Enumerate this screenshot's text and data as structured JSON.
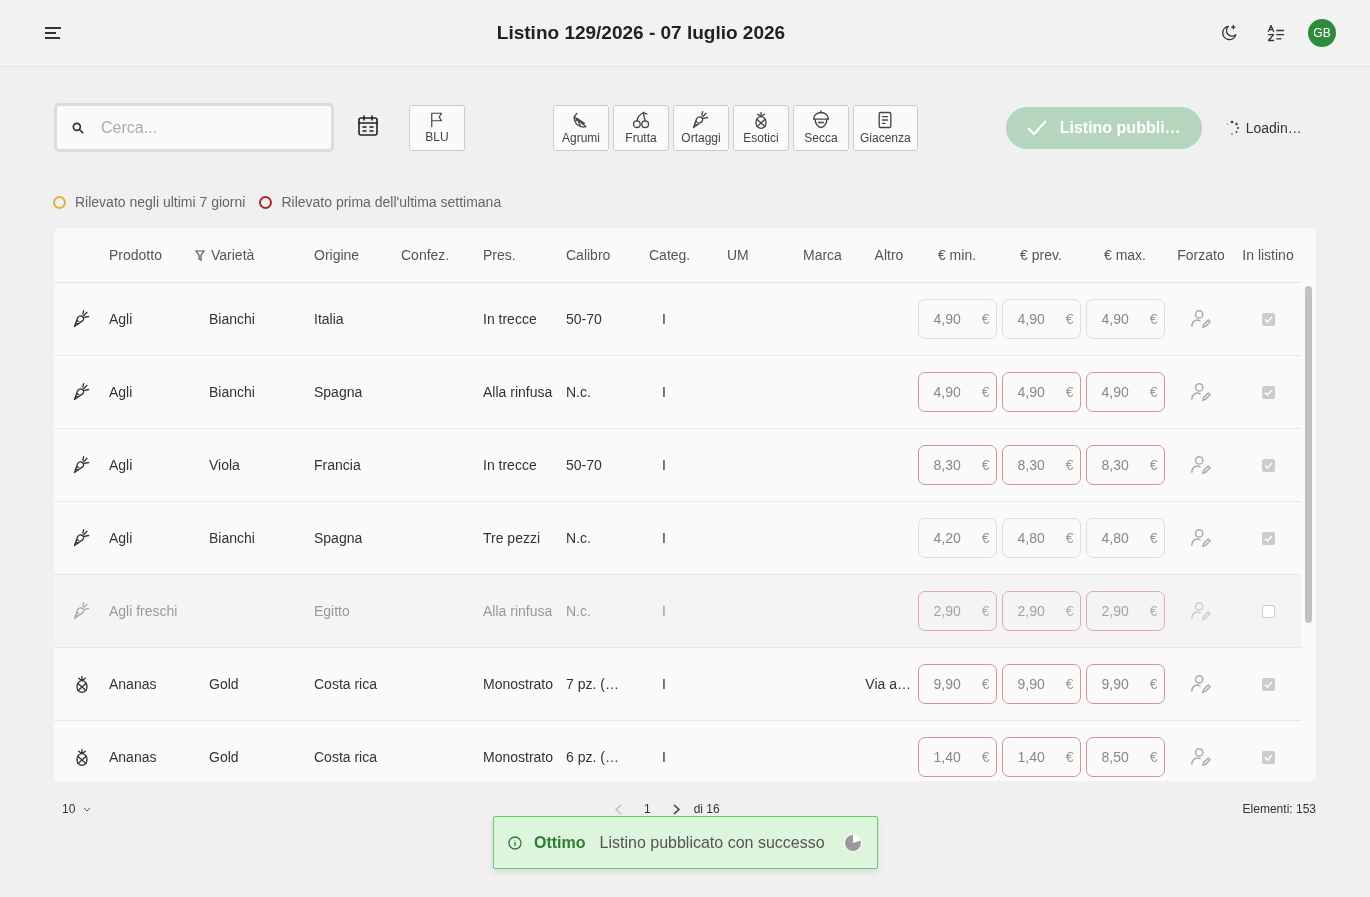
{
  "header": {
    "title": "Listino 129/2026 - 07 luglio 2026",
    "avatar": "GB"
  },
  "toolbar": {
    "search": {
      "placeholder": "Cerca..."
    },
    "flag_button": "BLU",
    "categories": [
      {
        "label": "Agrumi",
        "kind": "citrus"
      },
      {
        "label": "Frutta",
        "kind": "cherry"
      },
      {
        "label": "Ortaggi",
        "kind": "carrot"
      },
      {
        "label": "Esotici",
        "kind": "pineapple"
      },
      {
        "label": "Secca",
        "kind": "acorn"
      },
      {
        "label": "Giacenza",
        "kind": "document"
      }
    ],
    "publish_button": "Listino pubbli…",
    "loading": "Loadin…"
  },
  "legend": [
    {
      "label": "Rilevato negli ultimi 7 giorni",
      "color": "#e0b040"
    },
    {
      "label": "Rilevato prima dell'ultima settimana",
      "color": "#a52a2a"
    }
  ],
  "table": {
    "columns": [
      {
        "label": "Prodotto",
        "filter": false
      },
      {
        "label": "Varietà",
        "filter": true
      },
      {
        "label": "Origine",
        "filter": false
      },
      {
        "label": "Confez.",
        "filter": false
      },
      {
        "label": "Pres.",
        "filter": false
      },
      {
        "label": "Calibro",
        "filter": false
      },
      {
        "label": "Categ.",
        "filter": false
      },
      {
        "label": "UM",
        "filter": false
      },
      {
        "label": "Marca",
        "filter": false
      },
      {
        "label": "Altro",
        "filter": false
      },
      {
        "label": "€ min.",
        "filter": false
      },
      {
        "label": "€ prev.",
        "filter": false
      },
      {
        "label": "€ max.",
        "filter": false
      },
      {
        "label": "Forzato",
        "filter": false
      },
      {
        "label": "In listino",
        "filter": false
      }
    ],
    "rows": [
      {
        "kind": "carrot",
        "product": "Agli",
        "variety": "Bianchi",
        "origin": "Italia",
        "presentation": "In trecce",
        "caliber": "50-70",
        "category": "I",
        "prices": [
          {
            "value": "4,90",
            "unit": "€"
          },
          {
            "value": "4,90",
            "unit": "€"
          },
          {
            "value": "4,90",
            "unit": "€"
          }
        ],
        "flagged": false,
        "disabled": false,
        "in_listino": true
      },
      {
        "kind": "carrot",
        "product": "Agli",
        "variety": "Bianchi",
        "origin": "Spagna",
        "presentation": "Alla rinfusa",
        "caliber": "N.c.",
        "category": "I",
        "prices": [
          {
            "value": "4,90",
            "unit": "€"
          },
          {
            "value": "4,90",
            "unit": "€"
          },
          {
            "value": "4,90",
            "unit": "€"
          }
        ],
        "flagged": true,
        "disabled": false,
        "in_listino": true
      },
      {
        "kind": "carrot",
        "product": "Agli",
        "variety": "Viola",
        "origin": "Francia",
        "presentation": "In trecce",
        "caliber": "50-70",
        "category": "I",
        "prices": [
          {
            "value": "8,30",
            "unit": "€"
          },
          {
            "value": "8,30",
            "unit": "€"
          },
          {
            "value": "8,30",
            "unit": "€"
          }
        ],
        "flagged": true,
        "disabled": false,
        "in_listino": true
      },
      {
        "kind": "carrot",
        "product": "Agli",
        "variety": "Bianchi",
        "origin": "Spagna",
        "presentation": "Tre pezzi",
        "caliber": "N.c.",
        "category": "I",
        "prices": [
          {
            "value": "4,20",
            "unit": "€"
          },
          {
            "value": "4,80",
            "unit": "€"
          },
          {
            "value": "4,80",
            "unit": "€"
          }
        ],
        "flagged": false,
        "disabled": false,
        "in_listino": true
      },
      {
        "kind": "carrot",
        "product": "Agli freschi",
        "origin": "Egitto",
        "presentation": "Alla rinfusa",
        "caliber": "N.c.",
        "category": "I",
        "prices": [
          {
            "value": "2,90",
            "unit": "€"
          },
          {
            "value": "2,90",
            "unit": "€"
          },
          {
            "value": "2,90",
            "unit": "€"
          }
        ],
        "flagged": true,
        "disabled": true,
        "in_listino": false
      },
      {
        "kind": "pineapple",
        "product": "Ananas",
        "variety": "Gold",
        "origin": "Costa rica",
        "presentation": "Monostrato",
        "caliber": "7 pz. (…",
        "category": "I",
        "other": "Via a…",
        "prices": [
          {
            "value": "9,90",
            "unit": "€"
          },
          {
            "value": "9,90",
            "unit": "€"
          },
          {
            "value": "9,90",
            "unit": "€"
          }
        ],
        "flagged": true,
        "disabled": false,
        "in_listino": true
      },
      {
        "kind": "pineapple",
        "product": "Ananas",
        "variety": "Gold",
        "origin": "Costa rica",
        "presentation": "Monostrato",
        "caliber": "6 pz. (…",
        "category": "I",
        "prices": [
          {
            "value": "1,40",
            "unit": "€"
          },
          {
            "value": "1,40",
            "unit": "€"
          },
          {
            "value": "8,50",
            "unit": "€"
          }
        ],
        "flagged": true,
        "disabled": false,
        "in_listino": true
      }
    ]
  },
  "pagination": {
    "page_size": "10",
    "page": "1",
    "of_pages": "di 16",
    "total": "Elementi: 153"
  },
  "toast": {
    "title": "Ottimo",
    "message": "Listino pubblicato con successo"
  }
}
